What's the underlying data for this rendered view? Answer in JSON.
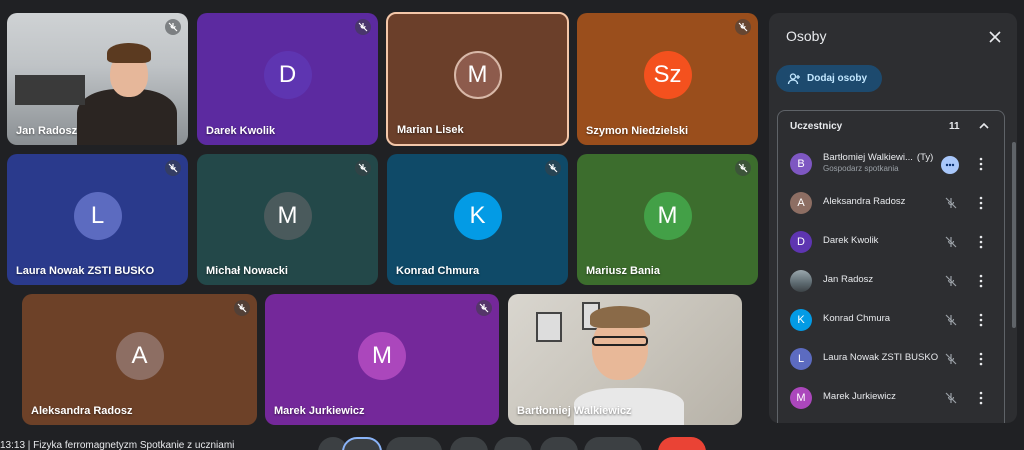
{
  "tiles": [
    {
      "name": "Jan Radosz",
      "type": "camera",
      "muted": true
    },
    {
      "name": "Darek Kwolik",
      "initial": "D",
      "avatar_color": "#5e35b1",
      "bg": "#5c2aa0",
      "muted": true
    },
    {
      "name": "Marian Lisek",
      "initial": "M",
      "avatar_color": "#8d5b4c",
      "bg": "#6b3f2a",
      "muted": false,
      "active": true
    },
    {
      "name": "Szymon Niedzielski",
      "initial": "Sz",
      "avatar_color": "#f4511e",
      "bg": "#9a4e1c",
      "muted": true
    },
    {
      "name": "Laura Nowak ZSTI BUSKO",
      "initial": "L",
      "avatar_color": "#5c6bc0",
      "bg": "#2a3a8c",
      "muted": true
    },
    {
      "name": "Michał Nowacki",
      "initial": "M",
      "avatar_color": "#4a5a5c",
      "bg": "#234849",
      "muted": true
    },
    {
      "name": "Konrad Chmura",
      "initial": "K",
      "avatar_color": "#039be5",
      "bg": "#0f4a68",
      "muted": true
    },
    {
      "name": "Mariusz Bania",
      "initial": "M",
      "avatar_color": "#43a047",
      "bg": "#3c6d2d",
      "muted": true
    },
    {
      "name": "Aleksandra Radosz",
      "initial": "A",
      "avatar_color": "#8d6e63",
      "bg": "#6d4128",
      "muted": true
    },
    {
      "name": "Marek Jurkiewicz",
      "initial": "M",
      "avatar_color": "#ab47bc",
      "bg": "#74289a",
      "muted": true
    },
    {
      "name": "Bartłomiej Walkiewicz",
      "type": "camera",
      "muted": false
    }
  ],
  "panel": {
    "title": "Osoby",
    "add_label": "Dodaj osoby",
    "section_label": "Uczestnicy",
    "section_count": "11",
    "participants": [
      {
        "name": "Bartłomiej Walkiewi...",
        "you": "(Ty)",
        "sub": "Gospodarz spotkania",
        "initial": "B",
        "color": "#7e57c2",
        "host": true
      },
      {
        "name": "Aleksandra Radosz",
        "initial": "A",
        "color": "#8d6e63"
      },
      {
        "name": "Darek Kwolik",
        "initial": "D",
        "color": "#5e35b1"
      },
      {
        "name": "Jan Radosz",
        "initial": "",
        "color": "#78909c",
        "photo": true
      },
      {
        "name": "Konrad Chmura",
        "initial": "K",
        "color": "#039be5"
      },
      {
        "name": "Laura Nowak ZSTI BUSKO",
        "initial": "L",
        "color": "#5c6bc0"
      },
      {
        "name": "Marek Jurkiewicz",
        "initial": "M",
        "color": "#ab47bc"
      }
    ]
  },
  "bottom": {
    "meeting_info": "13:13 | Fizyka ferromagnetyzm Spotkanie z uczniami"
  },
  "colors": {
    "background": "#202124",
    "panel": "#2d2e31",
    "accent": "#c2e7ff",
    "end_call": "#ea4335"
  }
}
